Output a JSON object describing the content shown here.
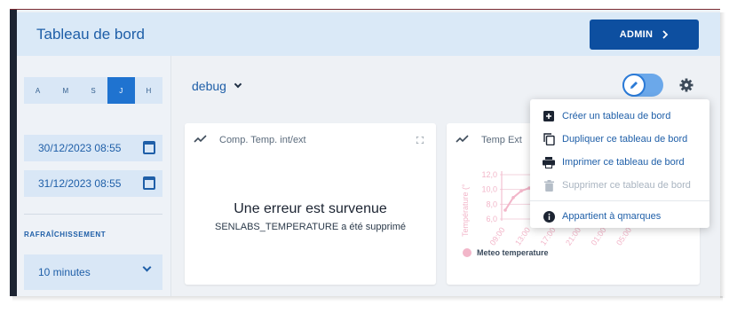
{
  "header": {
    "title": "Tableau de bord",
    "admin_label": "ADMIN"
  },
  "sidebar": {
    "periods": [
      {
        "label": "A",
        "active": false
      },
      {
        "label": "M",
        "active": false
      },
      {
        "label": "S",
        "active": false
      },
      {
        "label": "J",
        "active": true
      },
      {
        "label": "H",
        "active": false
      }
    ],
    "date_from": "30/12/2023 08:55",
    "date_to": "31/12/2023 08:55",
    "refresh_label": "RAFRAÎCHISSEMENT",
    "refresh_value": "10 minutes"
  },
  "toolbar": {
    "dashboard_name": "debug",
    "edit_toggle_on": true
  },
  "cards": [
    {
      "title": "Comp. Temp. int/ext",
      "error_title": "Une erreur est survenue",
      "error_detail": "SENLABS_TEMPERATURE a été supprimé"
    },
    {
      "title": "Temp Ext"
    }
  ],
  "menu": {
    "items": [
      {
        "label": "Créer un tableau de bord",
        "icon": "add-box-icon",
        "disabled": false
      },
      {
        "label": "Dupliquer ce tableau de bord",
        "icon": "copy-icon",
        "disabled": false
      },
      {
        "label": "Imprimer ce tableau de bord",
        "icon": "print-icon",
        "disabled": false
      },
      {
        "label": "Supprimer ce tableau de bord",
        "icon": "trash-icon",
        "disabled": true
      },
      {
        "label": "Appartient à qmarques",
        "icon": "info-icon",
        "disabled": false
      }
    ]
  },
  "chart_data": {
    "type": "line",
    "ylabel": "Température (°",
    "y_ticks": [
      "12,0",
      "10,0",
      "8,0",
      "6,0"
    ],
    "x_ticks": [
      "09:00",
      "13:00",
      "17:00",
      "21:00",
      "01:00",
      "05:00"
    ],
    "ylim": [
      6,
      12
    ],
    "series": [
      {
        "name": "Meteo temperature",
        "color": "#f2b6c9",
        "x": [
          0,
          1,
          2,
          3,
          4
        ],
        "values": [
          7.2,
          8.9,
          9.8,
          10.2,
          10.4
        ]
      }
    ]
  },
  "colors": {
    "accent": "#1f73d0",
    "admin_button": "#0d4fa0",
    "header_bg": "#dae9f7",
    "series": "#f2b6c9"
  }
}
